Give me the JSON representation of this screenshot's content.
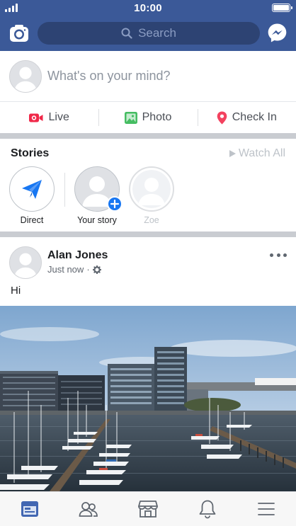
{
  "status_bar": {
    "time": "10:00"
  },
  "top_nav": {
    "search_placeholder": "Search"
  },
  "composer": {
    "prompt": "What's on your mind?",
    "actions": [
      {
        "label": "Live",
        "icon": "video-camera-icon",
        "color": "#f02849"
      },
      {
        "label": "Photo",
        "icon": "photo-icon",
        "color": "#45bd62"
      },
      {
        "label": "Check In",
        "icon": "location-pin-icon",
        "color": "#f3425f"
      }
    ]
  },
  "stories": {
    "title": "Stories",
    "watch_all": "Watch All",
    "items": [
      {
        "label": "Direct",
        "icon": "paper-plane-icon"
      },
      {
        "label": "Your story",
        "icon": "add-icon"
      },
      {
        "label": "Zoe"
      }
    ]
  },
  "post": {
    "author": "Alan Jones",
    "time": "Just now",
    "privacy_icon": "gear-icon",
    "text": "Hi"
  },
  "tab_bar": {
    "active": "news-feed",
    "items": [
      "news-feed-icon",
      "friends-icon",
      "marketplace-icon",
      "notifications-icon",
      "menu-icon"
    ]
  },
  "colors": {
    "brand": "#3b5998",
    "search_bg": "#2d4373",
    "accent_blue": "#1877f2",
    "tab_active": "#4267b2"
  }
}
